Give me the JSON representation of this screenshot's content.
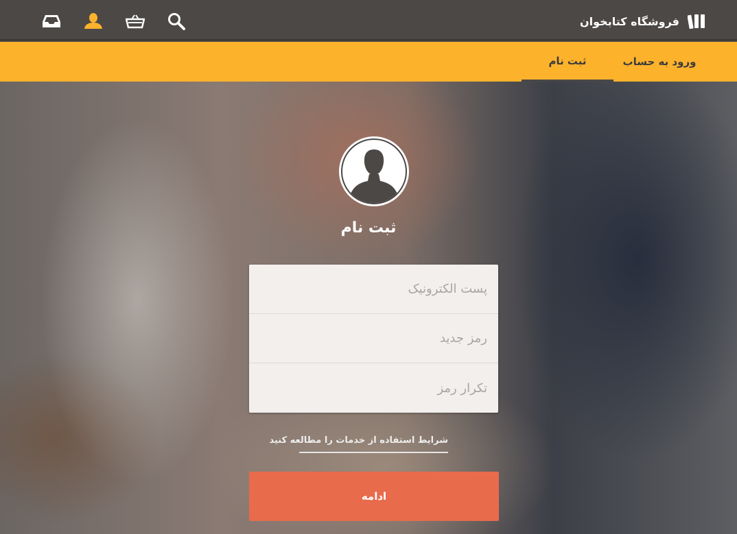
{
  "header": {
    "brand_name": "فروشگاه کتابخوان",
    "icons": [
      "inbox-icon",
      "user-icon",
      "basket-icon",
      "search-icon",
      "books-logo-icon"
    ],
    "accent_color": "#fdb22c"
  },
  "tabs": [
    {
      "label": "ورود به حساب",
      "active": false
    },
    {
      "label": "ثبت نام",
      "active": true
    }
  ],
  "form": {
    "title": "ثبت نام",
    "email_placeholder": "پست الکترونیک",
    "password_placeholder": "رمز جدید",
    "confirm_placeholder": "تکرار رمز",
    "terms_link": "شرایط استفاده از خدمات را مطالعه کنید",
    "submit_label": "ادامه",
    "submit_color": "#e86b4c"
  }
}
